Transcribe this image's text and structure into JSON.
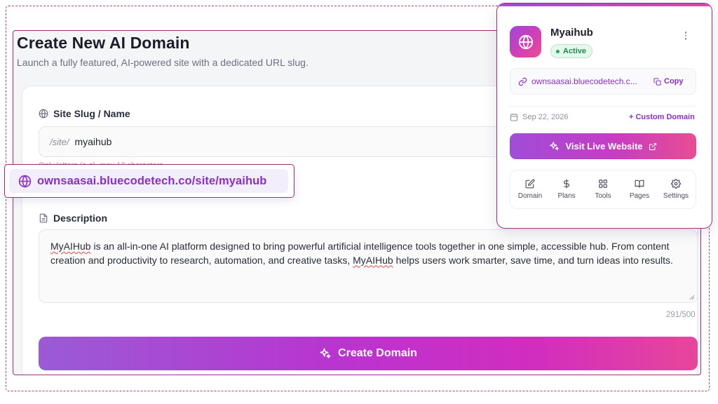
{
  "header": {
    "title": "Create New AI Domain",
    "subtitle": "Launch a fully featured, AI-powered site with a dedicated URL slug."
  },
  "form": {
    "slug": {
      "label": "Site Slug / Name",
      "prefix": "/site/",
      "value": "myaihub",
      "help": "Only letters (a-z), max 12 characters"
    },
    "url_preview": "ownsaasai.bluecodetech.co/site/myaihub",
    "description": {
      "label": "Description",
      "text_parts": [
        "",
        "MyAIHub",
        " is an all-in-one AI platform designed to bring powerful artificial intelligence tools together in one simple, accessible hub. From content creation and productivity to research, automation, and creative tasks, ",
        "MyAIHub",
        " helps users work smarter, save time, and turn ideas into results."
      ],
      "char_count": "291/500"
    },
    "submit_label": "Create Domain"
  },
  "domain_card": {
    "name": "Myaihub",
    "status": "Active",
    "url": "ownsaasai.bluecodetech.c...",
    "copy_label": "Copy",
    "date": "Sep 22, 2026",
    "custom_domain_label": "+ Custom Domain",
    "visit_label": "Visit Live Website",
    "actions": [
      {
        "label": "Domain",
        "icon": "edit-icon"
      },
      {
        "label": "Plans",
        "icon": "dollar-icon"
      },
      {
        "label": "Tools",
        "icon": "grid-icon"
      },
      {
        "label": "Pages",
        "icon": "book-icon"
      },
      {
        "label": "Settings",
        "icon": "gear-icon"
      }
    ]
  },
  "colors": {
    "accent": "#8a2fc4",
    "outline": "#9d2f78",
    "status_green": "#1f8a4c"
  }
}
